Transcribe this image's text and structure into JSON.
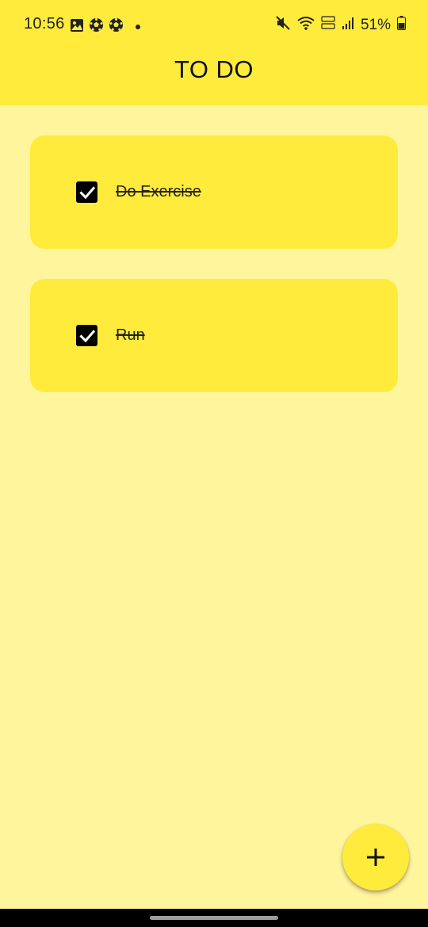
{
  "status_bar": {
    "time": "10:56",
    "left_icons": [
      "gallery-icon",
      "soccer-ball-icon",
      "soccer-ball-icon",
      "notification-dot-icon"
    ],
    "right_icons": [
      "mute-icon",
      "wifi-icon",
      "volte-icon",
      "signal-icon",
      "battery-icon"
    ],
    "battery_percent": "51%"
  },
  "header": {
    "title": "TO DO",
    "background": "#ffeb3b"
  },
  "todos": [
    {
      "label": "Do Exercise",
      "checked": true
    },
    {
      "label": "Run",
      "checked": true
    }
  ],
  "fab": {
    "icon": "plus-icon"
  },
  "colors": {
    "page_background": "#fff59d",
    "card_background": "#ffeb3b",
    "accent": "#ffeb3b"
  }
}
